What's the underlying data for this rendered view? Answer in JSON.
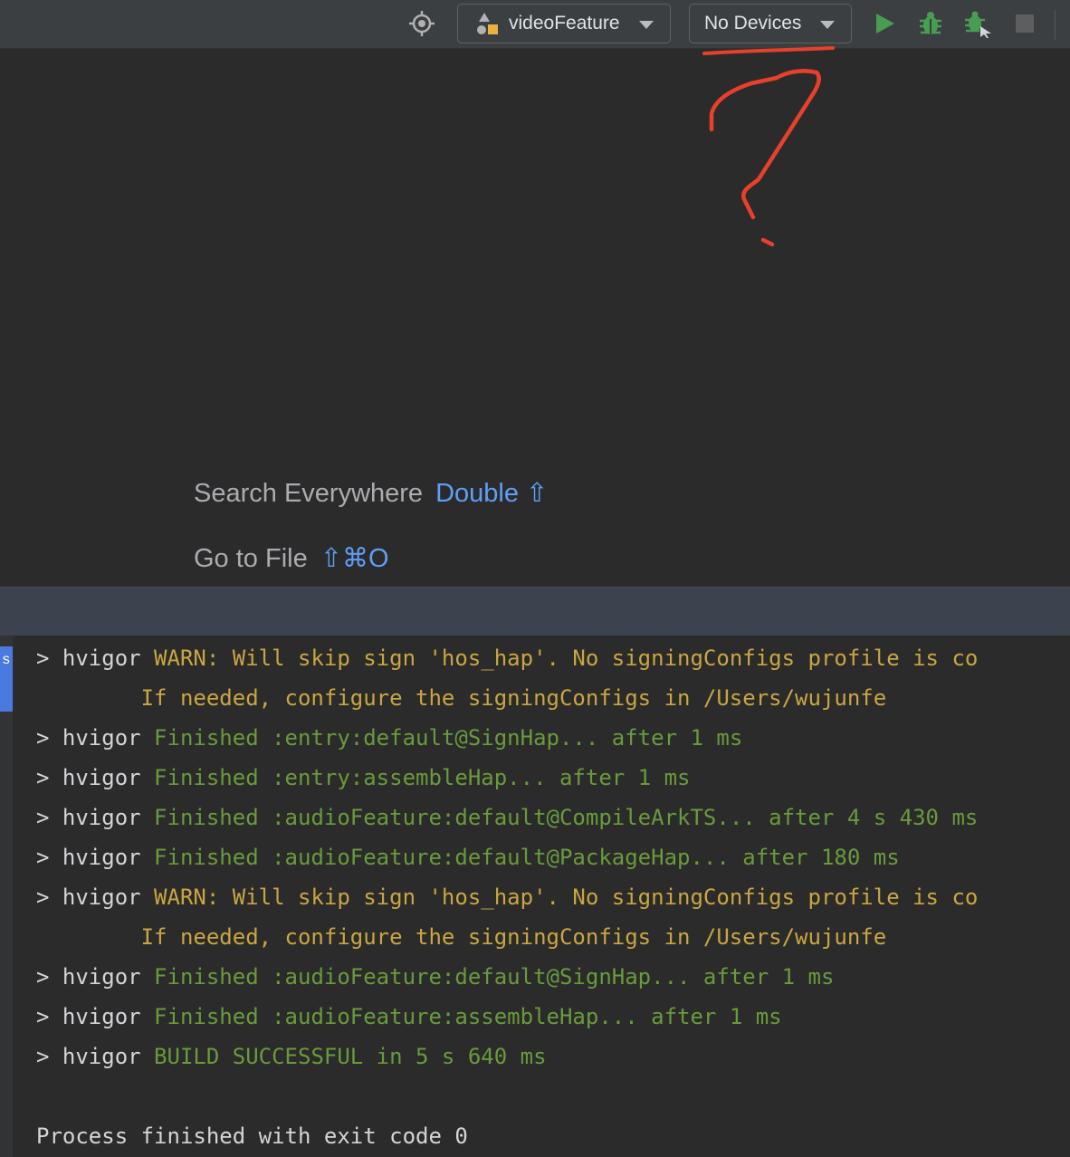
{
  "toolbar": {
    "module_selector": {
      "label": "videoFeature",
      "icon": "module-icon"
    },
    "device_selector": {
      "label": "No Devices"
    },
    "icons": [
      "locate-icon",
      "run-icon",
      "debug-icon",
      "attach-debugger-icon",
      "stop-icon"
    ],
    "colors": {
      "run": "#499c54",
      "debug": "#499c54",
      "stop": "#5c5e60"
    }
  },
  "editor": {
    "hints": [
      {
        "label": "Search Everywhere",
        "shortcut": "Double ⇧"
      },
      {
        "label": "Go to File",
        "shortcut": "⇧⌘O"
      }
    ]
  },
  "annotation": {
    "type": "hand-drawn red underline and question mark",
    "color": "#e8402a"
  },
  "run_panel": {
    "tab_label": "s",
    "lines": [
      {
        "prefix": "> hvigor ",
        "text": "WARN: Will skip sign 'hos_hap'. No signingConfigs profile is co",
        "kind": "warn"
      },
      {
        "prefix": "",
        "text": "        If needed, configure the signingConfigs in /Users/wujunfe",
        "kind": "warn"
      },
      {
        "prefix": "> hvigor ",
        "text": "Finished :entry:default@SignHap... after 1 ms",
        "kind": "ok"
      },
      {
        "prefix": "> hvigor ",
        "text": "Finished :entry:assembleHap... after 1 ms",
        "kind": "ok"
      },
      {
        "prefix": "> hvigor ",
        "text": "Finished :audioFeature:default@CompileArkTS... after 4 s 430 ms",
        "kind": "ok"
      },
      {
        "prefix": "> hvigor ",
        "text": "Finished :audioFeature:default@PackageHap... after 180 ms",
        "kind": "ok"
      },
      {
        "prefix": "> hvigor ",
        "text": "WARN: Will skip sign 'hos_hap'. No signingConfigs profile is co",
        "kind": "warn"
      },
      {
        "prefix": "",
        "text": "        If needed, configure the signingConfigs in /Users/wujunfe",
        "kind": "warn"
      },
      {
        "prefix": "> hvigor ",
        "text": "Finished :audioFeature:default@SignHap... after 1 ms",
        "kind": "ok"
      },
      {
        "prefix": "> hvigor ",
        "text": "Finished :audioFeature:assembleHap... after 1 ms",
        "kind": "ok"
      },
      {
        "prefix": "> hvigor ",
        "text": "BUILD SUCCESSFUL in 5 s 640 ms",
        "kind": "ok"
      },
      {
        "prefix": "",
        "text": "",
        "kind": "plain"
      },
      {
        "prefix": "",
        "text": "Process finished with exit code 0",
        "kind": "plain"
      }
    ]
  }
}
